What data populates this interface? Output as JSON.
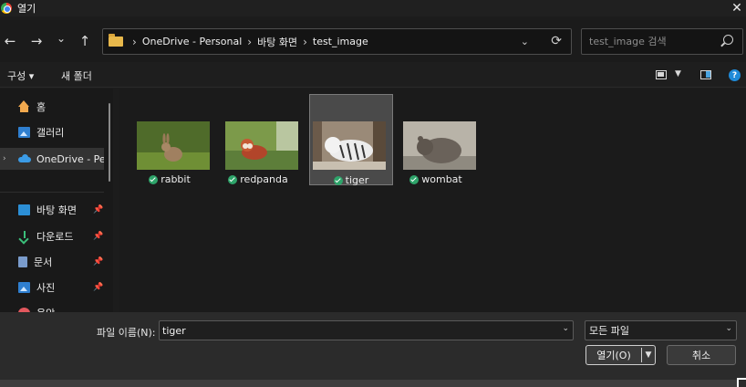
{
  "window": {
    "title": "열기"
  },
  "nav": {
    "back": "←",
    "forward": "→",
    "recent": "⌄",
    "up": "↑"
  },
  "address": {
    "crumbs": [
      "OneDrive - Personal",
      "바탕 화면",
      "test_image"
    ]
  },
  "search": {
    "placeholder": "test_image 검색",
    "value": ""
  },
  "toolbar": {
    "organize": "구성 ▾",
    "new_folder": "새 폴더",
    "help": "?"
  },
  "sidebar": {
    "items": [
      {
        "label": "홈",
        "icon": "home-icon"
      },
      {
        "label": "갤러리",
        "icon": "gallery-icon"
      },
      {
        "label": "OneDrive - Pers",
        "icon": "onedrive-icon",
        "selected": true,
        "expandable": true
      },
      {
        "label": "바탕 화면",
        "icon": "desktop-icon",
        "pinned": true
      },
      {
        "label": "다운로드",
        "icon": "download-icon",
        "pinned": true
      },
      {
        "label": "문서",
        "icon": "document-icon",
        "pinned": true
      },
      {
        "label": "사진",
        "icon": "pictures-icon",
        "pinned": true
      },
      {
        "label": "음악",
        "icon": "music-icon",
        "pinned": true
      }
    ]
  },
  "files": [
    {
      "name": "rabbit",
      "status": "synced"
    },
    {
      "name": "redpanda",
      "status": "synced"
    },
    {
      "name": "tiger",
      "status": "synced",
      "selected": true
    },
    {
      "name": "wombat",
      "status": "synced"
    }
  ],
  "footer": {
    "filename_label": "파일 이름(N):",
    "filename_value": "tiger",
    "filetype_value": "모든 파일",
    "open_label": "열기(O)",
    "cancel_label": "취소"
  }
}
